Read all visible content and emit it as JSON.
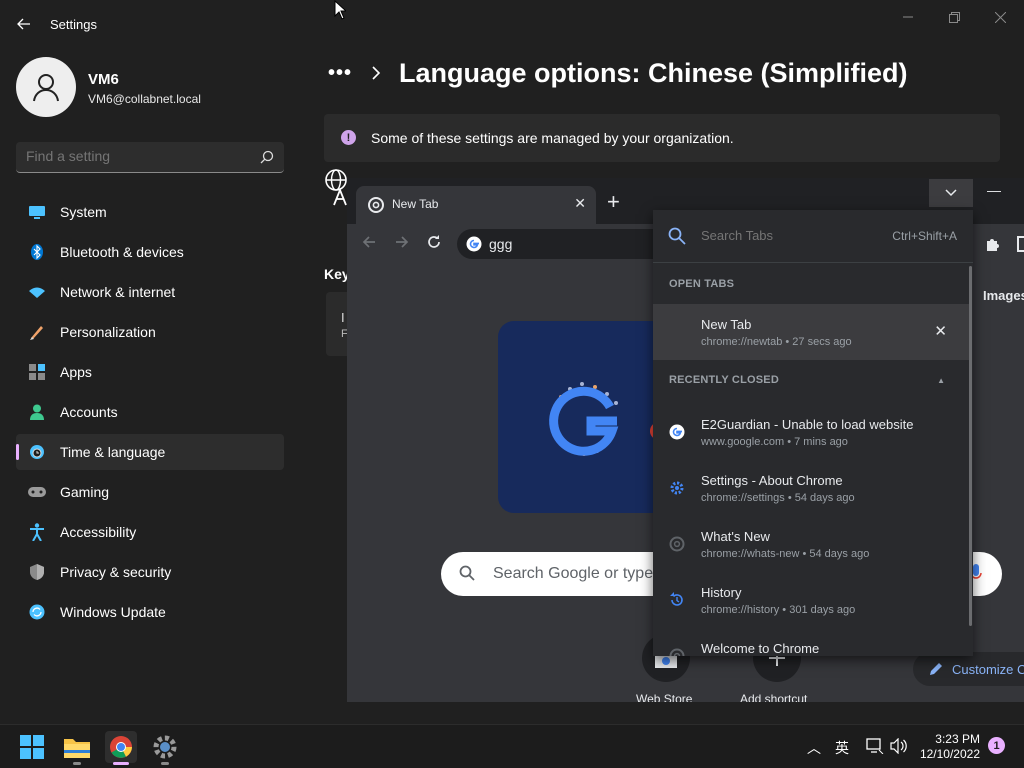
{
  "settings": {
    "app_title": "Settings",
    "user": {
      "name": "VM6",
      "email": "VM6@collabnet.local"
    },
    "search_placeholder": "Find a setting",
    "nav": [
      {
        "label": "System",
        "icon": "monitor-icon"
      },
      {
        "label": "Bluetooth & devices",
        "icon": "bluetooth-icon"
      },
      {
        "label": "Network & internet",
        "icon": "wifi-icon"
      },
      {
        "label": "Personalization",
        "icon": "brush-icon"
      },
      {
        "label": "Apps",
        "icon": "apps-icon"
      },
      {
        "label": "Accounts",
        "icon": "person-icon"
      },
      {
        "label": "Time & language",
        "icon": "globe-clock-icon"
      },
      {
        "label": "Gaming",
        "icon": "gamepad-icon"
      },
      {
        "label": "Accessibility",
        "icon": "accessibility-icon"
      },
      {
        "label": "Privacy & security",
        "icon": "shield-icon"
      },
      {
        "label": "Windows Update",
        "icon": "update-icon"
      }
    ],
    "active_nav": "Time & language",
    "breadcrumb_more": "•••",
    "page_title": "Language options: Chinese (Simplified)",
    "banner_text": "Some of these settings are managed by your organization.",
    "partial_section_label": "Key",
    "partial_card_text": "I",
    "partial_card_sub": "F"
  },
  "chrome": {
    "tab_title": "New Tab",
    "omnibox_value": "ggg",
    "images_link": "Images",
    "ntp_search_placeholder": "Search Google or type",
    "shortcuts": [
      {
        "label": "Web Store"
      },
      {
        "label": "Add shortcut"
      }
    ],
    "customize_label": "Customize C",
    "tab_search": {
      "placeholder": "Search Tabs",
      "shortcut": "Ctrl+Shift+A",
      "open_tabs_header": "OPEN TABS",
      "open_tabs": [
        {
          "title": "New Tab",
          "meta": "chrome://newtab • 27 secs ago"
        }
      ],
      "recently_closed_header": "RECENTLY CLOSED",
      "recently_closed": [
        {
          "title": "E2Guardian - Unable to load website",
          "meta": "www.google.com • 7 mins ago",
          "icon": "google-icon"
        },
        {
          "title": "Settings - About Chrome",
          "meta": "chrome://settings • 54 days ago",
          "icon": "gear-icon"
        },
        {
          "title": "What's New",
          "meta": "chrome://whats-new • 54 days ago",
          "icon": "chrome-icon"
        },
        {
          "title": "History",
          "meta": "chrome://history • 301 days ago",
          "icon": "history-icon"
        },
        {
          "title": "Welcome to Chrome",
          "meta": "",
          "icon": "chrome-icon"
        }
      ]
    }
  },
  "taskbar": {
    "ime_label": "英",
    "time": "3:23 PM",
    "date": "12/10/2022",
    "notification_count": "1"
  },
  "colors": {
    "accent": "#e9b0ff",
    "settings_bg": "#202020",
    "chrome_bg": "#35363a",
    "link_blue": "#8ab4f8"
  }
}
